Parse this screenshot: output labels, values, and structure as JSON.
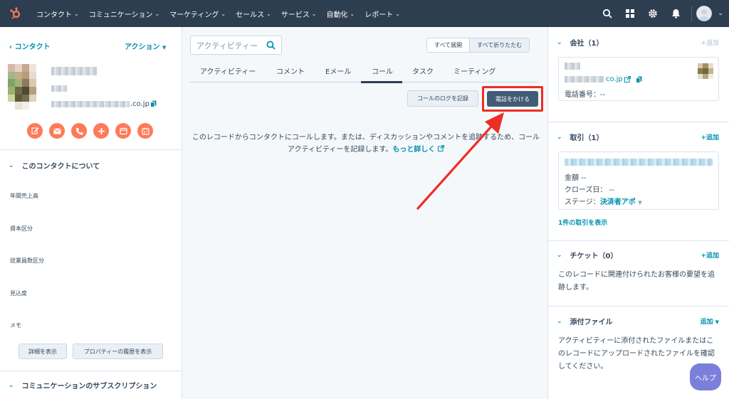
{
  "nav": {
    "items": [
      "コンタクト",
      "コミュニケーション",
      "マーケティング",
      "セールス",
      "サービス",
      "自動化",
      "レポート"
    ]
  },
  "left": {
    "back_label": "コンタクト",
    "action_label": "アクション",
    "email_suffix": ".co.jp",
    "section_about": "このコンタクトについて",
    "properties": [
      "年間売上高",
      "資本区分",
      "従業員数区分",
      "見込度",
      "メモ"
    ],
    "details_button": "詳細を表示",
    "history_button": "プロパティーの履歴を表示",
    "section_subscriptions": "コミュニケーションのサブスクリプション"
  },
  "center": {
    "search_placeholder": "アクティビティー",
    "expand_all": "すべて展開",
    "collapse_all": "すべて折りたたむ",
    "tabs": [
      "アクティビティー",
      "コメント",
      "Eメール",
      "コール",
      "タスク",
      "ミーティング"
    ],
    "active_tab": "コール",
    "log_call_button": "コールのログを記録",
    "make_call_button": "電話をかける",
    "description_line1": "このレコードからコンタクトにコールします。または、ディスカッションやコメントを追跡するため、コール",
    "description_line2": "アクティビティーを記録します。",
    "learn_more": "もっと詳しく"
  },
  "right": {
    "company": {
      "title": "会社（1）",
      "add": "+追加",
      "domain_suffix": "co.jp",
      "phone_label": "電話番号：--"
    },
    "deals": {
      "title": "取引（1）",
      "add": "+追加",
      "amount": "金額 --",
      "close_date": "クローズ日： --",
      "stage_label": "ステージ：",
      "stage_value": "決済者アポ",
      "view_link": "1件の取引を表示"
    },
    "tickets": {
      "title": "チケット（0）",
      "add": "+追加",
      "body_line1": "このレコードに関連付けられたお客様の要望を追",
      "body_line2": "跡します。"
    },
    "attachments": {
      "title": "添付ファイル",
      "add": "追加",
      "body_line1": "アクティビティーに添付されたファイルまたはこ",
      "body_line2": "のレコードにアップロードされたファイルを確認",
      "body_line3": "してください。"
    }
  },
  "help_label": "ヘルプ",
  "colors": {
    "nav_bg": "#2d3e50",
    "accent": "#0091ae",
    "action_orange": "#ff7a59",
    "highlight_red": "#ee2d24",
    "primary_button": "#425b76"
  }
}
